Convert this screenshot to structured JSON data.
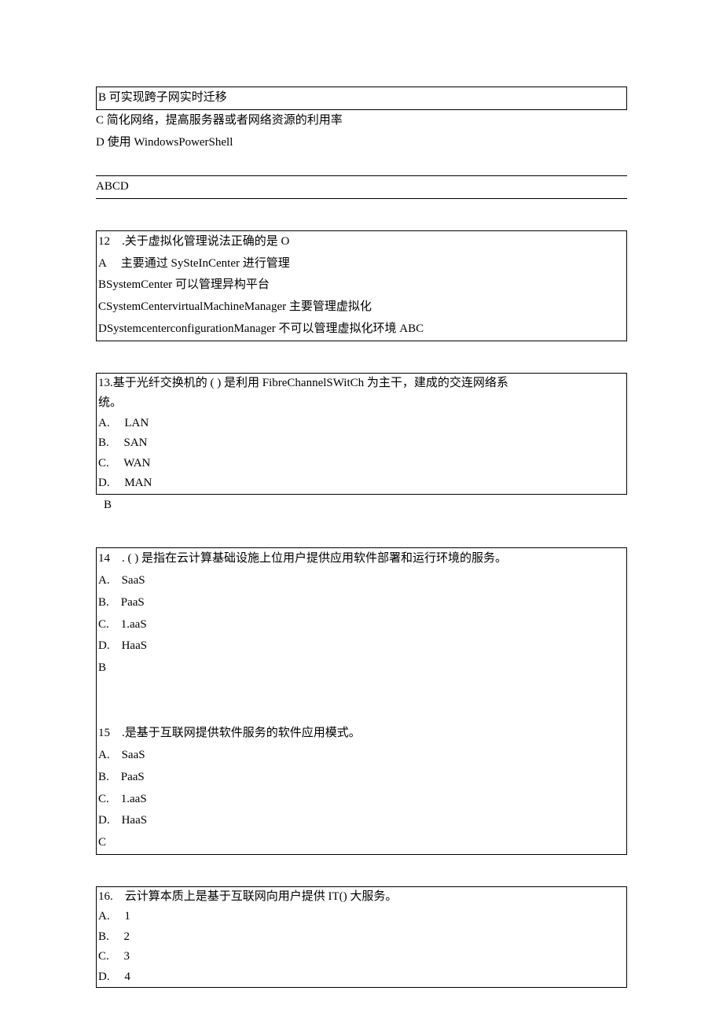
{
  "q11": {
    "opt_b": "B 可实现跨子网实时迁移",
    "opt_c": "C 简化网络，提高服务器或者网络资源的利用率",
    "opt_d": "D 使用 WindowsPowerShell",
    "answer": "ABCD"
  },
  "q12": {
    "stem": "12　.关于虚拟化管理说法正确的是 O",
    "opt_a": "A　 主要通过 SySteInCenter 进行管理",
    "opt_b": "BSystemCenter 可以管理异构平台",
    "opt_c": "CSystemCentervirtualMachineManager 主要管理虚拟化",
    "opt_d_ans": "DSystemcenterconfigurationManager 不可以管理虚拟化环境 ABC"
  },
  "q13": {
    "stem_line1": "13.基于光纤交换机的 ( ) 是利用 FibreChannelSWitCh 为主干，建成的交连网络系",
    "stem_line2": "统。",
    "opt_a": "A.　 LAN",
    "opt_b": "B.　 SAN",
    "opt_c": "C.　 WAN",
    "opt_d": "D.　 MAN",
    "answer": "B"
  },
  "q14": {
    "stem": "14　. ( ) 是指在云计算基础设施上位用户提供应用软件部署和运行环境的服务。",
    "opt_a": "A.　SaaS",
    "opt_b": "B.　PaaS",
    "opt_c": "C.　1.aaS",
    "opt_d": "D.　HaaS",
    "answer": "B"
  },
  "q15": {
    "stem": "15　.是基于互联网提供软件服务的软件应用模式。",
    "opt_a": "A.　SaaS",
    "opt_b": "B.　PaaS",
    "opt_c": "C.　1.aaS",
    "opt_d": "D.　HaaS",
    "answer": "C"
  },
  "q16": {
    "stem": "16.　云计算本质上是基于互联网向用户提供 IT() 大服务。",
    "opt_a": "A.　 1",
    "opt_b": "B.　 2",
    "opt_c": "C.　 3",
    "opt_d": "D.　 4"
  }
}
